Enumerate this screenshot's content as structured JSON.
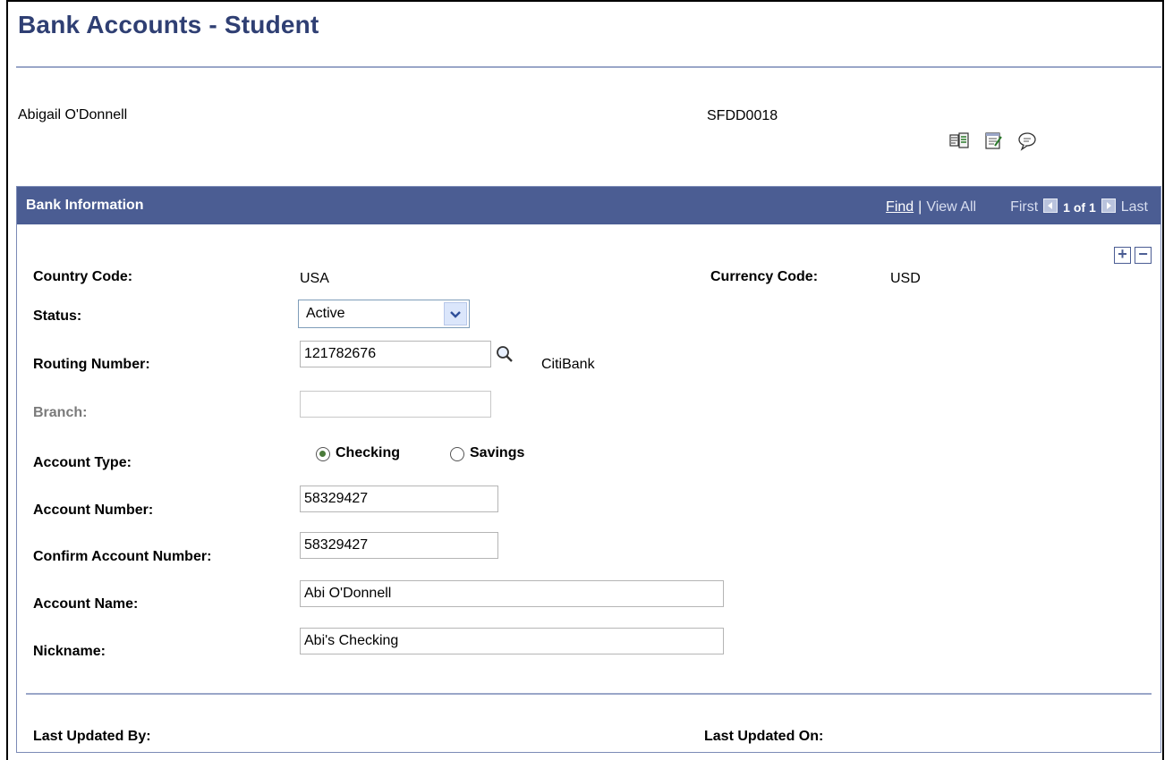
{
  "page": {
    "title": "Bank Accounts - Student"
  },
  "student": {
    "name": "Abigail O'Donnell",
    "id": "SFDD0018"
  },
  "toolbar_icons": [
    "reports-icon",
    "notepad-icon",
    "comments-icon"
  ],
  "panel": {
    "title": "Bank Information",
    "nav": {
      "find": "Find",
      "separator": "|",
      "view_all": "View All",
      "first": "First",
      "pager": "1 of 1",
      "last": "Last"
    }
  },
  "form": {
    "country_code": {
      "label": "Country Code:",
      "value": "USA"
    },
    "currency_code": {
      "label": "Currency Code:",
      "value": "USD"
    },
    "status": {
      "label": "Status:",
      "value": "Active"
    },
    "routing_number": {
      "label": "Routing Number:",
      "value": "121782676",
      "bank_name": "CitiBank"
    },
    "branch": {
      "label": "Branch:",
      "value": ""
    },
    "account_type": {
      "label": "Account Type:",
      "options": [
        "Checking",
        "Savings"
      ],
      "selected": "Checking"
    },
    "account_number": {
      "label": "Account Number:",
      "value": "58329427"
    },
    "confirm_account_number": {
      "label": "Confirm Account Number:",
      "value": "58329427"
    },
    "account_name": {
      "label": "Account Name:",
      "value": "Abi O'Donnell"
    },
    "nickname": {
      "label": "Nickname:",
      "value": "Abi's Checking"
    },
    "last_updated_by": {
      "label": "Last Updated By:"
    },
    "last_updated_on": {
      "label": "Last Updated On:"
    }
  }
}
